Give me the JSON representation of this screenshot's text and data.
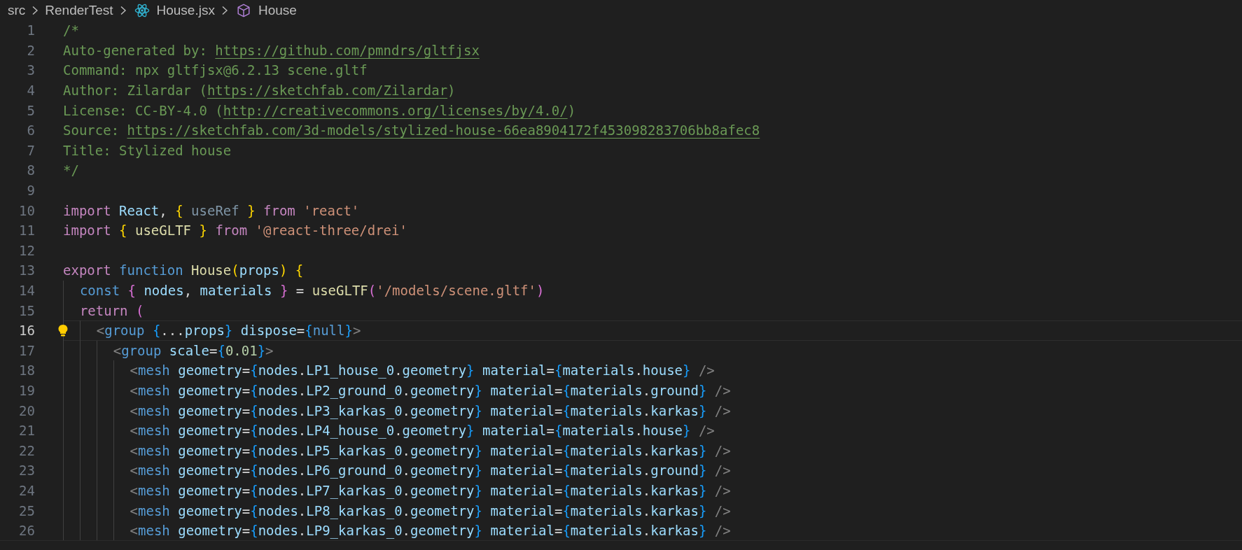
{
  "breadcrumb": [
    {
      "kind": "folder",
      "label": "src"
    },
    {
      "kind": "folder",
      "label": "RenderTest"
    },
    {
      "kind": "file",
      "label": "House.jsx"
    },
    {
      "kind": "symbol",
      "label": "House"
    }
  ],
  "lines": [
    {
      "number": "1",
      "current": false,
      "lightbulb": false,
      "tokens": [
        {
          "kind": "comment",
          "text": "/*"
        }
      ]
    },
    {
      "number": "2",
      "current": false,
      "lightbulb": false,
      "tokens": [
        {
          "kind": "comment",
          "text": "Auto-generated by: "
        },
        {
          "kind": "link",
          "text": "https://github.com/pmndrs/gltfjsx"
        }
      ]
    },
    {
      "number": "3",
      "current": false,
      "lightbulb": false,
      "tokens": [
        {
          "kind": "comment",
          "text": "Command: npx gltfjsx@6.2.13 scene.gltf"
        }
      ]
    },
    {
      "number": "4",
      "current": false,
      "lightbulb": false,
      "tokens": [
        {
          "kind": "comment",
          "text": "Author: Zilardar ("
        },
        {
          "kind": "link",
          "text": "https://sketchfab.com/Zilardar"
        },
        {
          "kind": "comment",
          "text": ")"
        }
      ]
    },
    {
      "number": "5",
      "current": false,
      "lightbulb": false,
      "tokens": [
        {
          "kind": "comment",
          "text": "License: CC-BY-4.0 ("
        },
        {
          "kind": "link",
          "text": "http://creativecommons.org/licenses/by/4.0/"
        },
        {
          "kind": "comment",
          "text": ")"
        }
      ]
    },
    {
      "number": "6",
      "current": false,
      "lightbulb": false,
      "tokens": [
        {
          "kind": "comment",
          "text": "Source: "
        },
        {
          "kind": "link",
          "text": "https://sketchfab.com/3d-models/stylized-house-66ea8904172f453098283706bb8afec8"
        }
      ]
    },
    {
      "number": "7",
      "current": false,
      "lightbulb": false,
      "tokens": [
        {
          "kind": "comment",
          "text": "Title: Stylized house"
        }
      ]
    },
    {
      "number": "8",
      "current": false,
      "lightbulb": false,
      "tokens": [
        {
          "kind": "comment",
          "text": "*/"
        }
      ]
    },
    {
      "number": "9",
      "current": false,
      "lightbulb": false
    },
    {
      "number": "10",
      "current": false,
      "lightbulb": false,
      "tokens": [
        {
          "kind": "keyword",
          "text": "import "
        },
        {
          "kind": "variable",
          "text": "React"
        },
        {
          "kind": "punct",
          "text": ", "
        },
        {
          "kind": "bracket1",
          "text": "{ "
        },
        {
          "kind": "unused",
          "text": "useRef "
        },
        {
          "kind": "bracket1",
          "text": "}"
        },
        {
          "kind": "keyword",
          "text": " from "
        },
        {
          "kind": "string",
          "text": "'react'"
        }
      ]
    },
    {
      "number": "11",
      "current": false,
      "lightbulb": false,
      "tokens": [
        {
          "kind": "keyword",
          "text": "import "
        },
        {
          "kind": "bracket1",
          "text": "{ "
        },
        {
          "kind": "function",
          "text": "useGLTF "
        },
        {
          "kind": "bracket1",
          "text": "}"
        },
        {
          "kind": "keyword",
          "text": " from "
        },
        {
          "kind": "string",
          "text": "'@react-three/drei'"
        }
      ]
    },
    {
      "number": "12",
      "current": false,
      "lightbulb": false
    },
    {
      "number": "13",
      "current": false,
      "lightbulb": false,
      "tokens": [
        {
          "kind": "keyword",
          "text": "export "
        },
        {
          "kind": "storage",
          "text": "function "
        },
        {
          "kind": "function",
          "text": "House"
        },
        {
          "kind": "bracket1",
          "text": "("
        },
        {
          "kind": "variable",
          "text": "props"
        },
        {
          "kind": "bracket1",
          "text": ") {"
        }
      ]
    },
    {
      "number": "14",
      "current": false,
      "lightbulb": false,
      "tokens": [
        {
          "kind": "storage",
          "text": "  const "
        },
        {
          "kind": "bracket2",
          "text": "{ "
        },
        {
          "kind": "variable",
          "text": "nodes"
        },
        {
          "kind": "punct",
          "text": ", "
        },
        {
          "kind": "variable",
          "text": "materials "
        },
        {
          "kind": "bracket2",
          "text": "}"
        },
        {
          "kind": "punct",
          "text": " = "
        },
        {
          "kind": "function",
          "text": "useGLTF"
        },
        {
          "kind": "bracket2",
          "text": "("
        },
        {
          "kind": "string",
          "text": "'/models/scene.gltf'"
        },
        {
          "kind": "bracket2",
          "text": ")"
        }
      ]
    },
    {
      "number": "15",
      "current": false,
      "lightbulb": false,
      "tokens": [
        {
          "kind": "keyword",
          "text": "  return "
        },
        {
          "kind": "bracket2",
          "text": "("
        }
      ]
    },
    {
      "number": "16",
      "current": true,
      "lightbulb": true,
      "tokens": [
        {
          "kind": "tag",
          "text": "    <"
        },
        {
          "kind": "tagname",
          "text": "group "
        },
        {
          "kind": "bracket3",
          "text": "{"
        },
        {
          "kind": "punct",
          "text": "..."
        },
        {
          "kind": "variable",
          "text": "props"
        },
        {
          "kind": "bracket3",
          "text": "} "
        },
        {
          "kind": "variable",
          "text": "dispose"
        },
        {
          "kind": "punct",
          "text": "="
        },
        {
          "kind": "bracket3",
          "text": "{"
        },
        {
          "kind": "storage",
          "text": "null"
        },
        {
          "kind": "bracket3",
          "text": "}"
        },
        {
          "kind": "tag",
          "text": ">"
        }
      ]
    },
    {
      "number": "17",
      "current": false,
      "lightbulb": false,
      "tokens": [
        {
          "kind": "tag",
          "text": "      <"
        },
        {
          "kind": "tagname",
          "text": "group "
        },
        {
          "kind": "variable",
          "text": "scale"
        },
        {
          "kind": "punct",
          "text": "="
        },
        {
          "kind": "bracket3",
          "text": "{"
        },
        {
          "kind": "number",
          "text": "0.01"
        },
        {
          "kind": "bracket3",
          "text": "}"
        },
        {
          "kind": "tag",
          "text": ">"
        }
      ]
    },
    {
      "number": "18",
      "current": false,
      "lightbulb": false,
      "tokens": [
        {
          "kind": "tag",
          "text": "        <"
        },
        {
          "kind": "tagname",
          "text": "mesh "
        },
        {
          "kind": "variable",
          "text": "geometry"
        },
        {
          "kind": "punct",
          "text": "="
        },
        {
          "kind": "bracket3",
          "text": "{"
        },
        {
          "kind": "variable",
          "text": "nodes"
        },
        {
          "kind": "punct",
          "text": "."
        },
        {
          "kind": "variable",
          "text": "LP1_house_0"
        },
        {
          "kind": "punct",
          "text": "."
        },
        {
          "kind": "variable",
          "text": "geometry"
        },
        {
          "kind": "bracket3",
          "text": "} "
        },
        {
          "kind": "variable",
          "text": "material"
        },
        {
          "kind": "punct",
          "text": "="
        },
        {
          "kind": "bracket3",
          "text": "{"
        },
        {
          "kind": "variable",
          "text": "materials"
        },
        {
          "kind": "punct",
          "text": "."
        },
        {
          "kind": "variable",
          "text": "house"
        },
        {
          "kind": "bracket3",
          "text": "} "
        },
        {
          "kind": "tag",
          "text": "/>"
        }
      ]
    },
    {
      "number": "19",
      "current": false,
      "lightbulb": false,
      "tokens": [
        {
          "kind": "tag",
          "text": "        <"
        },
        {
          "kind": "tagname",
          "text": "mesh "
        },
        {
          "kind": "variable",
          "text": "geometry"
        },
        {
          "kind": "punct",
          "text": "="
        },
        {
          "kind": "bracket3",
          "text": "{"
        },
        {
          "kind": "variable",
          "text": "nodes"
        },
        {
          "kind": "punct",
          "text": "."
        },
        {
          "kind": "variable",
          "text": "LP2_ground_0"
        },
        {
          "kind": "punct",
          "text": "."
        },
        {
          "kind": "variable",
          "text": "geometry"
        },
        {
          "kind": "bracket3",
          "text": "} "
        },
        {
          "kind": "variable",
          "text": "material"
        },
        {
          "kind": "punct",
          "text": "="
        },
        {
          "kind": "bracket3",
          "text": "{"
        },
        {
          "kind": "variable",
          "text": "materials"
        },
        {
          "kind": "punct",
          "text": "."
        },
        {
          "kind": "variable",
          "text": "ground"
        },
        {
          "kind": "bracket3",
          "text": "} "
        },
        {
          "kind": "tag",
          "text": "/>"
        }
      ]
    },
    {
      "number": "20",
      "current": false,
      "lightbulb": false,
      "tokens": [
        {
          "kind": "tag",
          "text": "        <"
        },
        {
          "kind": "tagname",
          "text": "mesh "
        },
        {
          "kind": "variable",
          "text": "geometry"
        },
        {
          "kind": "punct",
          "text": "="
        },
        {
          "kind": "bracket3",
          "text": "{"
        },
        {
          "kind": "variable",
          "text": "nodes"
        },
        {
          "kind": "punct",
          "text": "."
        },
        {
          "kind": "variable",
          "text": "LP3_karkas_0"
        },
        {
          "kind": "punct",
          "text": "."
        },
        {
          "kind": "variable",
          "text": "geometry"
        },
        {
          "kind": "bracket3",
          "text": "} "
        },
        {
          "kind": "variable",
          "text": "material"
        },
        {
          "kind": "punct",
          "text": "="
        },
        {
          "kind": "bracket3",
          "text": "{"
        },
        {
          "kind": "variable",
          "text": "materials"
        },
        {
          "kind": "punct",
          "text": "."
        },
        {
          "kind": "variable",
          "text": "karkas"
        },
        {
          "kind": "bracket3",
          "text": "} "
        },
        {
          "kind": "tag",
          "text": "/>"
        }
      ]
    },
    {
      "number": "21",
      "current": false,
      "lightbulb": false,
      "tokens": [
        {
          "kind": "tag",
          "text": "        <"
        },
        {
          "kind": "tagname",
          "text": "mesh "
        },
        {
          "kind": "variable",
          "text": "geometry"
        },
        {
          "kind": "punct",
          "text": "="
        },
        {
          "kind": "bracket3",
          "text": "{"
        },
        {
          "kind": "variable",
          "text": "nodes"
        },
        {
          "kind": "punct",
          "text": "."
        },
        {
          "kind": "variable",
          "text": "LP4_house_0"
        },
        {
          "kind": "punct",
          "text": "."
        },
        {
          "kind": "variable",
          "text": "geometry"
        },
        {
          "kind": "bracket3",
          "text": "} "
        },
        {
          "kind": "variable",
          "text": "material"
        },
        {
          "kind": "punct",
          "text": "="
        },
        {
          "kind": "bracket3",
          "text": "{"
        },
        {
          "kind": "variable",
          "text": "materials"
        },
        {
          "kind": "punct",
          "text": "."
        },
        {
          "kind": "variable",
          "text": "house"
        },
        {
          "kind": "bracket3",
          "text": "} "
        },
        {
          "kind": "tag",
          "text": "/>"
        }
      ]
    },
    {
      "number": "22",
      "current": false,
      "lightbulb": false,
      "tokens": [
        {
          "kind": "tag",
          "text": "        <"
        },
        {
          "kind": "tagname",
          "text": "mesh "
        },
        {
          "kind": "variable",
          "text": "geometry"
        },
        {
          "kind": "punct",
          "text": "="
        },
        {
          "kind": "bracket3",
          "text": "{"
        },
        {
          "kind": "variable",
          "text": "nodes"
        },
        {
          "kind": "punct",
          "text": "."
        },
        {
          "kind": "variable",
          "text": "LP5_karkas_0"
        },
        {
          "kind": "punct",
          "text": "."
        },
        {
          "kind": "variable",
          "text": "geometry"
        },
        {
          "kind": "bracket3",
          "text": "} "
        },
        {
          "kind": "variable",
          "text": "material"
        },
        {
          "kind": "punct",
          "text": "="
        },
        {
          "kind": "bracket3",
          "text": "{"
        },
        {
          "kind": "variable",
          "text": "materials"
        },
        {
          "kind": "punct",
          "text": "."
        },
        {
          "kind": "variable",
          "text": "karkas"
        },
        {
          "kind": "bracket3",
          "text": "} "
        },
        {
          "kind": "tag",
          "text": "/>"
        }
      ]
    },
    {
      "number": "23",
      "current": false,
      "lightbulb": false,
      "tokens": [
        {
          "kind": "tag",
          "text": "        <"
        },
        {
          "kind": "tagname",
          "text": "mesh "
        },
        {
          "kind": "variable",
          "text": "geometry"
        },
        {
          "kind": "punct",
          "text": "="
        },
        {
          "kind": "bracket3",
          "text": "{"
        },
        {
          "kind": "variable",
          "text": "nodes"
        },
        {
          "kind": "punct",
          "text": "."
        },
        {
          "kind": "variable",
          "text": "LP6_ground_0"
        },
        {
          "kind": "punct",
          "text": "."
        },
        {
          "kind": "variable",
          "text": "geometry"
        },
        {
          "kind": "bracket3",
          "text": "} "
        },
        {
          "kind": "variable",
          "text": "material"
        },
        {
          "kind": "punct",
          "text": "="
        },
        {
          "kind": "bracket3",
          "text": "{"
        },
        {
          "kind": "variable",
          "text": "materials"
        },
        {
          "kind": "punct",
          "text": "."
        },
        {
          "kind": "variable",
          "text": "ground"
        },
        {
          "kind": "bracket3",
          "text": "} "
        },
        {
          "kind": "tag",
          "text": "/>"
        }
      ]
    },
    {
      "number": "24",
      "current": false,
      "lightbulb": false,
      "tokens": [
        {
          "kind": "tag",
          "text": "        <"
        },
        {
          "kind": "tagname",
          "text": "mesh "
        },
        {
          "kind": "variable",
          "text": "geometry"
        },
        {
          "kind": "punct",
          "text": "="
        },
        {
          "kind": "bracket3",
          "text": "{"
        },
        {
          "kind": "variable",
          "text": "nodes"
        },
        {
          "kind": "punct",
          "text": "."
        },
        {
          "kind": "variable",
          "text": "LP7_karkas_0"
        },
        {
          "kind": "punct",
          "text": "."
        },
        {
          "kind": "variable",
          "text": "geometry"
        },
        {
          "kind": "bracket3",
          "text": "} "
        },
        {
          "kind": "variable",
          "text": "material"
        },
        {
          "kind": "punct",
          "text": "="
        },
        {
          "kind": "bracket3",
          "text": "{"
        },
        {
          "kind": "variable",
          "text": "materials"
        },
        {
          "kind": "punct",
          "text": "."
        },
        {
          "kind": "variable",
          "text": "karkas"
        },
        {
          "kind": "bracket3",
          "text": "} "
        },
        {
          "kind": "tag",
          "text": "/>"
        }
      ]
    },
    {
      "number": "25",
      "current": false,
      "lightbulb": false,
      "tokens": [
        {
          "kind": "tag",
          "text": "        <"
        },
        {
          "kind": "tagname",
          "text": "mesh "
        },
        {
          "kind": "variable",
          "text": "geometry"
        },
        {
          "kind": "punct",
          "text": "="
        },
        {
          "kind": "bracket3",
          "text": "{"
        },
        {
          "kind": "variable",
          "text": "nodes"
        },
        {
          "kind": "punct",
          "text": "."
        },
        {
          "kind": "variable",
          "text": "LP8_karkas_0"
        },
        {
          "kind": "punct",
          "text": "."
        },
        {
          "kind": "variable",
          "text": "geometry"
        },
        {
          "kind": "bracket3",
          "text": "} "
        },
        {
          "kind": "variable",
          "text": "material"
        },
        {
          "kind": "punct",
          "text": "="
        },
        {
          "kind": "bracket3",
          "text": "{"
        },
        {
          "kind": "variable",
          "text": "materials"
        },
        {
          "kind": "punct",
          "text": "."
        },
        {
          "kind": "variable",
          "text": "karkas"
        },
        {
          "kind": "bracket3",
          "text": "} "
        },
        {
          "kind": "tag",
          "text": "/>"
        }
      ]
    },
    {
      "number": "26",
      "current": false,
      "lightbulb": false,
      "tokens": [
        {
          "kind": "tag",
          "text": "        <"
        },
        {
          "kind": "tagname",
          "text": "mesh "
        },
        {
          "kind": "variable",
          "text": "geometry"
        },
        {
          "kind": "punct",
          "text": "="
        },
        {
          "kind": "bracket3",
          "text": "{"
        },
        {
          "kind": "variable",
          "text": "nodes"
        },
        {
          "kind": "punct",
          "text": "."
        },
        {
          "kind": "variable",
          "text": "LP9_karkas_0"
        },
        {
          "kind": "punct",
          "text": "."
        },
        {
          "kind": "variable",
          "text": "geometry"
        },
        {
          "kind": "bracket3",
          "text": "} "
        },
        {
          "kind": "variable",
          "text": "material"
        },
        {
          "kind": "punct",
          "text": "="
        },
        {
          "kind": "bracket3",
          "text": "{"
        },
        {
          "kind": "variable",
          "text": "materials"
        },
        {
          "kind": "punct",
          "text": "."
        },
        {
          "kind": "variable",
          "text": "karkas"
        },
        {
          "kind": "bracket3",
          "text": "} "
        },
        {
          "kind": "tag",
          "text": "/>"
        }
      ]
    }
  ]
}
